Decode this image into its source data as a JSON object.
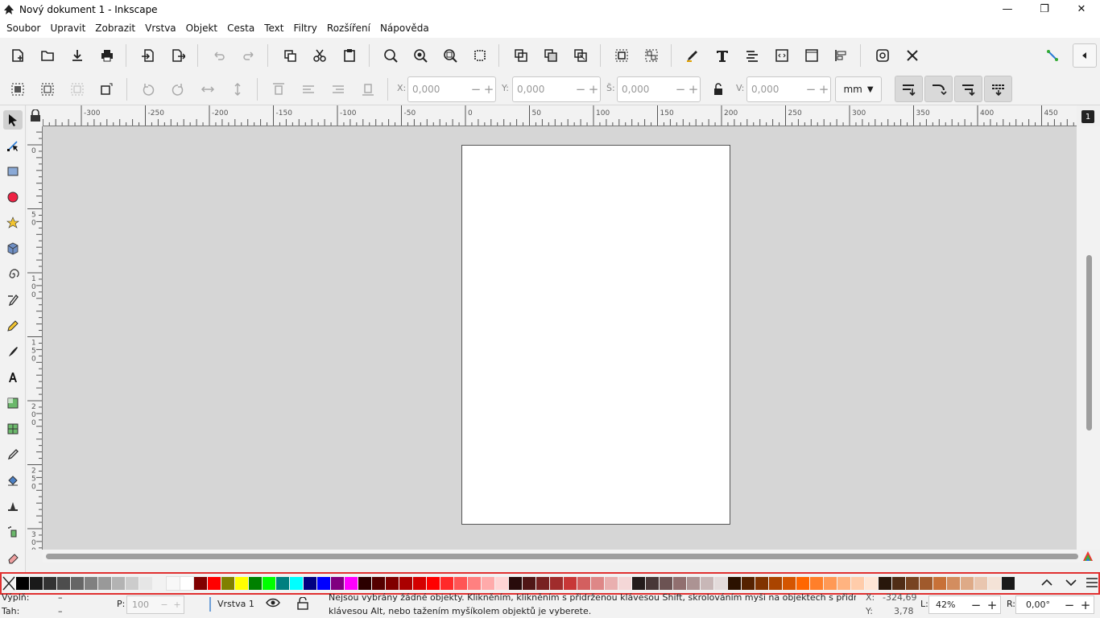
{
  "window": {
    "title": "Nový dokument 1 - Inkscape",
    "controls": [
      "minimize-icon",
      "maximize-icon",
      "close-icon"
    ]
  },
  "menu": [
    "Soubor",
    "Upravit",
    "Zobrazit",
    "Vrstva",
    "Objekt",
    "Cesta",
    "Text",
    "Filtry",
    "Rozšíření",
    "Nápověda"
  ],
  "toolbar": {
    "x_label": "X:",
    "x_value": "0,000",
    "y_label": "Y:",
    "y_value": "0,000",
    "w_label": "Š:",
    "w_value": "0,000",
    "h_label": "V:",
    "h_value": "0,000",
    "unit": "mm"
  },
  "rulers": {
    "h_ticks": [
      "-300",
      "-250",
      "-200",
      "-150",
      "-100",
      "-50",
      "0",
      "50",
      "100",
      "150",
      "200",
      "250",
      "300",
      "350",
      "400",
      "450"
    ],
    "v_ticks": [
      "0",
      "50",
      "100",
      "150",
      "200",
      "250",
      "300"
    ],
    "corner_badge": "1"
  },
  "palette": {
    "colors": [
      "#000000",
      "#1a1a1a",
      "#333333",
      "#4d4d4d",
      "#666666",
      "#808080",
      "#999999",
      "#b3b3b3",
      "#cccccc",
      "#e6e6e6",
      "#f2f2f2",
      "#f8f8f8",
      "#ffffff",
      "#800000",
      "#ff0000",
      "#808000",
      "#ffff00",
      "#008000",
      "#00ff00",
      "#008080",
      "#00ffff",
      "#000080",
      "#0000ff",
      "#800080",
      "#ff00ff",
      "#2b0000",
      "#550000",
      "#800000",
      "#aa0000",
      "#d40000",
      "#ff0000",
      "#ff2a2a",
      "#ff5555",
      "#ff8080",
      "#ffaaaa",
      "#ffd5d5",
      "#280b0b",
      "#501616",
      "#782121",
      "#a02c2c",
      "#c83737",
      "#d35f5f",
      "#de8787",
      "#e9afaf",
      "#f4d7d7",
      "#241c1c",
      "#483737",
      "#6c5353",
      "#916f6f",
      "#ac9393",
      "#c8b7b7",
      "#e3dbdb",
      "#2b1100",
      "#552200",
      "#803300",
      "#aa4400",
      "#d45500",
      "#ff6600",
      "#ff7f2a",
      "#ff9955",
      "#ffb380",
      "#ffccaa",
      "#ffe6d5",
      "#28170b",
      "#502d16",
      "#784421",
      "#a05a2c",
      "#c87137",
      "#d38d5f",
      "#deaa87",
      "#e9c6af",
      "#f4e3d7",
      "#1a1a1a"
    ]
  },
  "status": {
    "fill_label": "Výplň:",
    "fill_value": "–",
    "stroke_label": "Tah:",
    "stroke_value": "–",
    "opacity_label": "P:",
    "opacity_value": "100",
    "layer": "Vrstva 1",
    "message_line1": "Nejsou vybrány žádné objekty. Klikněním, klikněním s přidrženou klávesou Shift, skrolováním myši na objektech s přidrženou",
    "message_line2": "klávesou Alt, nebo tažením myšíkolem objektů je vyberete.",
    "x_label": "X:",
    "x_value": "-324,69",
    "y_label": "Y:",
    "y_value": "3,78",
    "zoom_label": "L:",
    "zoom_value": "42%",
    "rotate_label": "R:",
    "rotate_value": "0,00°"
  }
}
